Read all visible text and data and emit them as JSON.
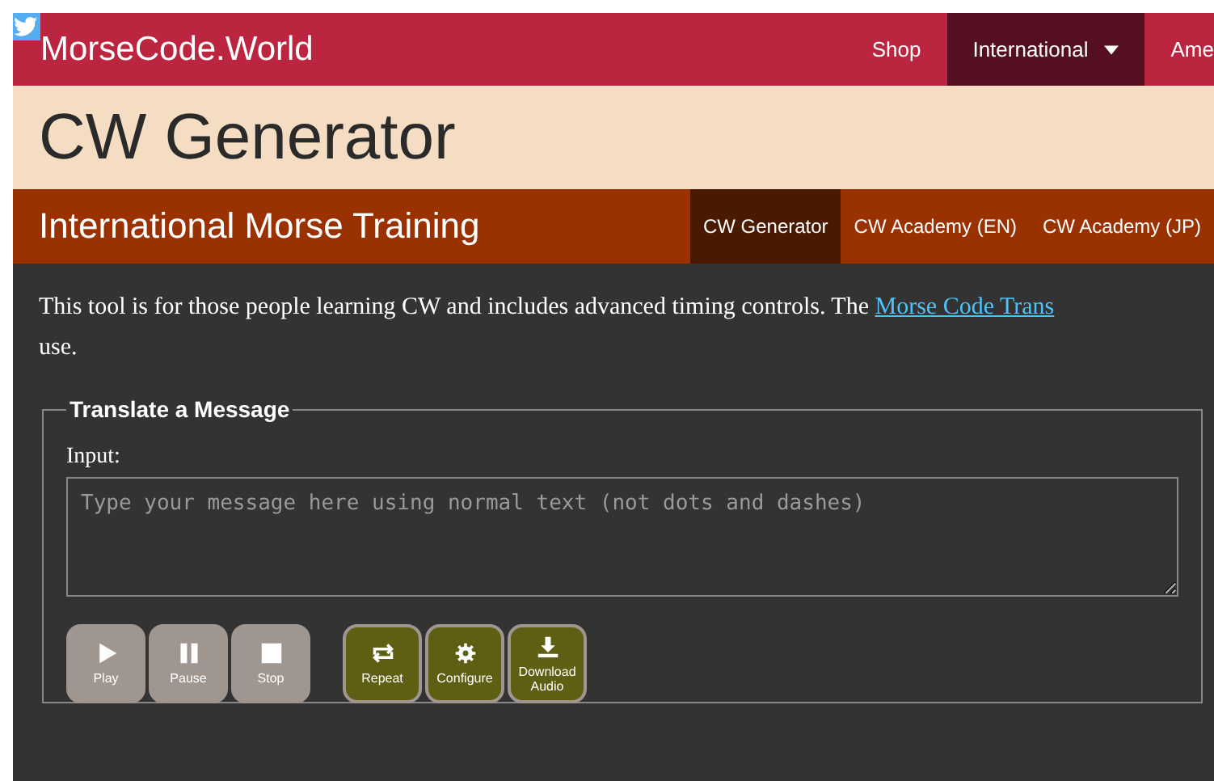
{
  "brand": "MorseCode.World",
  "nav": [
    {
      "label": "Shop",
      "selected": false,
      "dropdown": false
    },
    {
      "label": "International",
      "selected": true,
      "dropdown": true
    },
    {
      "label": "Ame",
      "selected": false,
      "dropdown": false
    }
  ],
  "page_title": "CW Generator",
  "section_title": "International Morse Training",
  "tabs": [
    {
      "label": "CW Generator",
      "selected": true
    },
    {
      "label": "CW Academy (EN)",
      "selected": false
    },
    {
      "label": "CW Academy (JP)",
      "selected": false
    }
  ],
  "intro": {
    "text": "This tool is for those people learning CW and includes advanced timing controls. The",
    "link": "Morse Code Trans",
    "after": "use."
  },
  "panel": {
    "legend": "Translate a Message",
    "input_label": "Input:",
    "placeholder": "Type your message here using normal text (not dots and dashes)"
  },
  "buttons": [
    {
      "label": "Play",
      "kind": "play",
      "disabled": true
    },
    {
      "label": "Pause",
      "kind": "pause",
      "disabled": true
    },
    {
      "label": "Stop",
      "kind": "stop",
      "disabled": true
    },
    {
      "label": "Repeat",
      "kind": "repeat",
      "disabled": false
    },
    {
      "label": "Configure",
      "kind": "configure",
      "disabled": false
    },
    {
      "label": "Download Audio",
      "kind": "download",
      "disabled": false
    }
  ]
}
